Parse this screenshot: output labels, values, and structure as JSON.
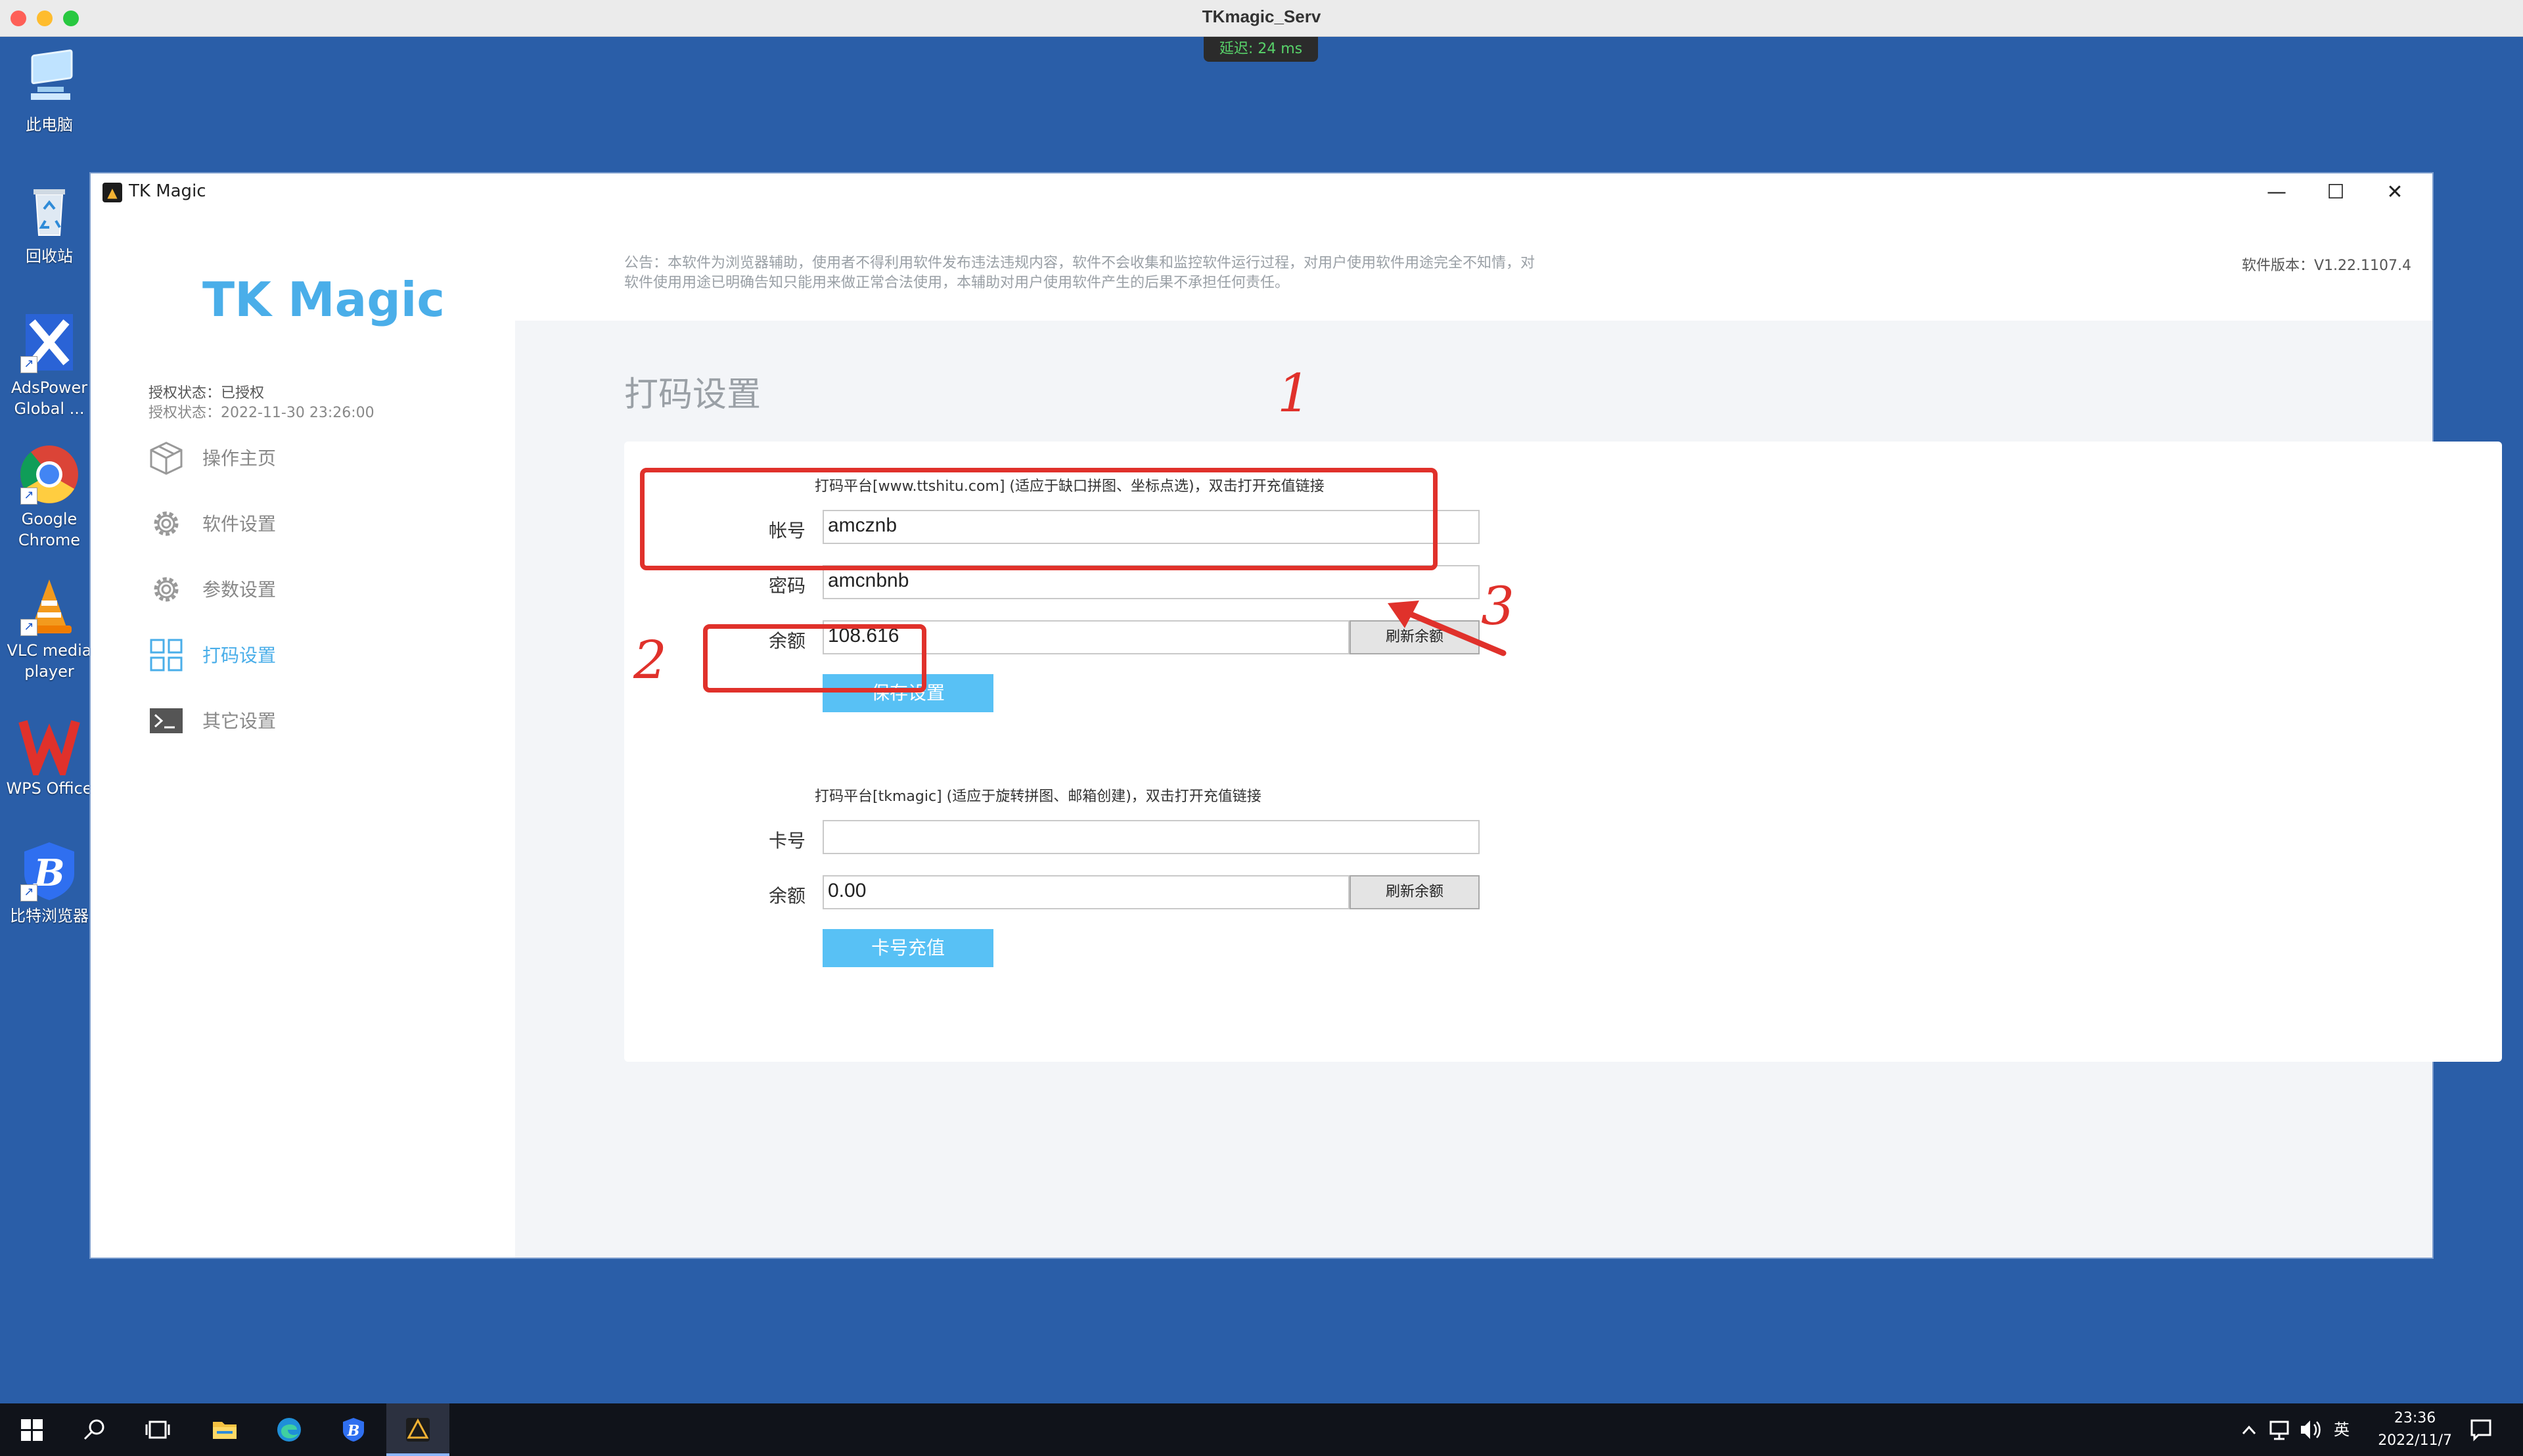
{
  "outer_window": {
    "title": "TKmagic_Serv",
    "latency_badge": "延迟: 24 ms"
  },
  "desktop": {
    "icons": [
      {
        "label": "此电脑"
      },
      {
        "label": "回收站"
      },
      {
        "label": "AdsPower Global ..."
      },
      {
        "label": "Google Chrome"
      },
      {
        "label": "VLC media player"
      },
      {
        "label": "WPS Office"
      },
      {
        "label": "比特浏览器"
      }
    ]
  },
  "window": {
    "title": "TK Magic",
    "controls": {
      "minimize": "—",
      "maximize": "☐",
      "close": "✕"
    }
  },
  "sidebar": {
    "brand": "TK Magic",
    "auth_status": "授权状态：已授权",
    "auth_expiry": "授权状态：2022-11-30 23:26:00",
    "nav": [
      {
        "label": "操作主页",
        "icon": "cube-icon"
      },
      {
        "label": "软件设置",
        "icon": "gear-icon"
      },
      {
        "label": "参数设置",
        "icon": "gear-icon"
      },
      {
        "label": "打码设置",
        "icon": "grid-icon",
        "active": true
      },
      {
        "label": "其它设置",
        "icon": "terminal-icon"
      }
    ]
  },
  "header": {
    "notice": "公告：本软件为浏览器辅助，使用者不得利用软件发布违法违规内容，软件不会收集和监控软件运行过程，对用户使用软件用途完全不知情，对软件使用用途已明确告知只能用来做正常合法使用，本辅助对用户使用软件产生的后果不承担任何责任。",
    "version": "软件版本：V1.22.1107.4"
  },
  "page": {
    "title": "打码设置",
    "section1": {
      "hint": "打码平台[www.ttshitu.com] (适应于缺口拼图、坐标点选)，双击打开充值链接",
      "account_label": "帐号",
      "account_value": "amcznb",
      "password_label": "密码",
      "password_value": "amcnbnb",
      "balance_label": "余额",
      "balance_value": "108.616",
      "refresh_label": "刷新余额",
      "save_label": "保存设置"
    },
    "section2": {
      "hint": "打码平台[tkmagic] (适应于旋转拼图、邮箱创建)，双击打开充值链接",
      "card_label": "卡号",
      "card_value": "",
      "balance_label": "余额",
      "balance_value": "0.00",
      "refresh_label": "刷新余额",
      "recharge_label": "卡号充值"
    }
  },
  "annotations": {
    "one": "1",
    "two": "2",
    "three": "3",
    "color": "#e0312b"
  },
  "taskbar": {
    "items": [
      "windows-start-icon",
      "search-icon",
      "task-view-icon",
      "file-explorer-icon",
      "edge-icon",
      "bitbrowser-icon",
      "tkmagic-icon"
    ],
    "ime": "英",
    "time": "23:36",
    "date": "2022/11/7"
  },
  "colors": {
    "accent": "#4aaee9",
    "button_blue": "#58c1f5",
    "desktop": "#2a5ea8",
    "annotation_red": "#e0312b"
  }
}
